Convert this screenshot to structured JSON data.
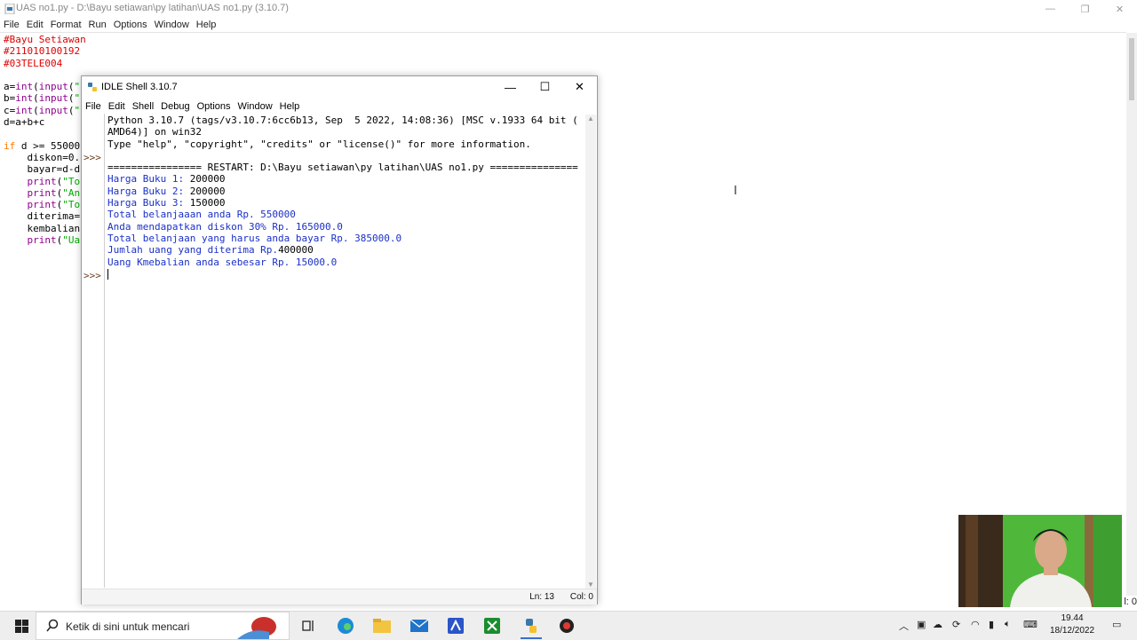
{
  "editor": {
    "title": "UAS no1.py - D:\\Bayu setiawan\\py latihan\\UAS no1.py (3.10.7)",
    "menu": [
      "File",
      "Edit",
      "Format",
      "Run",
      "Options",
      "Window",
      "Help"
    ],
    "code": {
      "l1": "#Bayu Setiawan",
      "l2": "#211010100192",
      "l3": "#03TELE004",
      "l5a": "a=",
      "l5b": "int",
      "l5c": "(",
      "l5d": "input",
      "l5e": "(",
      "l5f": "\"",
      "l6a": "b=",
      "l6b": "int",
      "l6c": "(",
      "l6d": "input",
      "l6e": "(",
      "l6f": "\"",
      "l7a": "c=",
      "l7b": "int",
      "l7c": "(",
      "l7d": "input",
      "l7e": "(",
      "l7f": "\"",
      "l8": "d=a+b+c",
      "l10a": "if",
      "l10b": " d >= 55000",
      "l11": "    diskon=0.",
      "l12": "    bayar=d-d",
      "l13a": "    ",
      "l13b": "print",
      "l13c": "(",
      "l13d": "\"To",
      "l14a": "    ",
      "l14b": "print",
      "l14c": "(",
      "l14d": "\"An",
      "l15a": "    ",
      "l15b": "print",
      "l15c": "(",
      "l15d": "\"To",
      "l16": "    diterima=",
      "l17": "    kembalian",
      "l18a": "    ",
      "l18b": "print",
      "l18c": "(",
      "l18d": "\"Ua"
    },
    "status_col": "l: 0"
  },
  "shell": {
    "title": "IDLE Shell 3.10.7",
    "menu": [
      "File",
      "Edit",
      "Shell",
      "Debug",
      "Options",
      "Window",
      "Help"
    ],
    "prompt": ">>>",
    "lines": {
      "h1": "Python 3.10.7 (tags/v3.10.7:6cc6b13, Sep  5 2022, 14:08:36) [MSC v.1933 64 bit (",
      "h2": "AMD64)] on win32",
      "h3": "Type \"help\", \"copyright\", \"credits\" or \"license()\" for more information.",
      "restart": "================ RESTART: D:\\Bayu setiawan\\py latihan\\UAS no1.py ===============",
      "o1": "Harga Buku 1: ",
      "u1": "200000",
      "o2": "Harga Buku 2: ",
      "u2": "200000",
      "o3": "Harga Buku 3: ",
      "u3": "150000",
      "o4": "Total belanjaaan anda Rp. 550000",
      "o5": "Anda mendapatkan diskon 30% Rp. 165000.0",
      "o6": "Total belanjaan yang harus anda bayar Rp. 385000.0",
      "o7": "Jumlah uang yang diterima Rp.",
      "u7": "400000",
      "o8": "Uang Kmebalian anda sebesar Rp. 15000.0"
    },
    "status": {
      "ln": "Ln: 13",
      "col": "Col: 0"
    }
  },
  "taskbar": {
    "search_placeholder": "Ketik di sini untuk mencari",
    "time": "19.44",
    "date": "18/12/2022"
  },
  "colors": {
    "comment": "#dd0000",
    "keyword": "#ff7700",
    "builtin": "#900090",
    "string": "#00aa00",
    "shell_output": "#1a30c8",
    "accent": "#3a6fd0"
  }
}
